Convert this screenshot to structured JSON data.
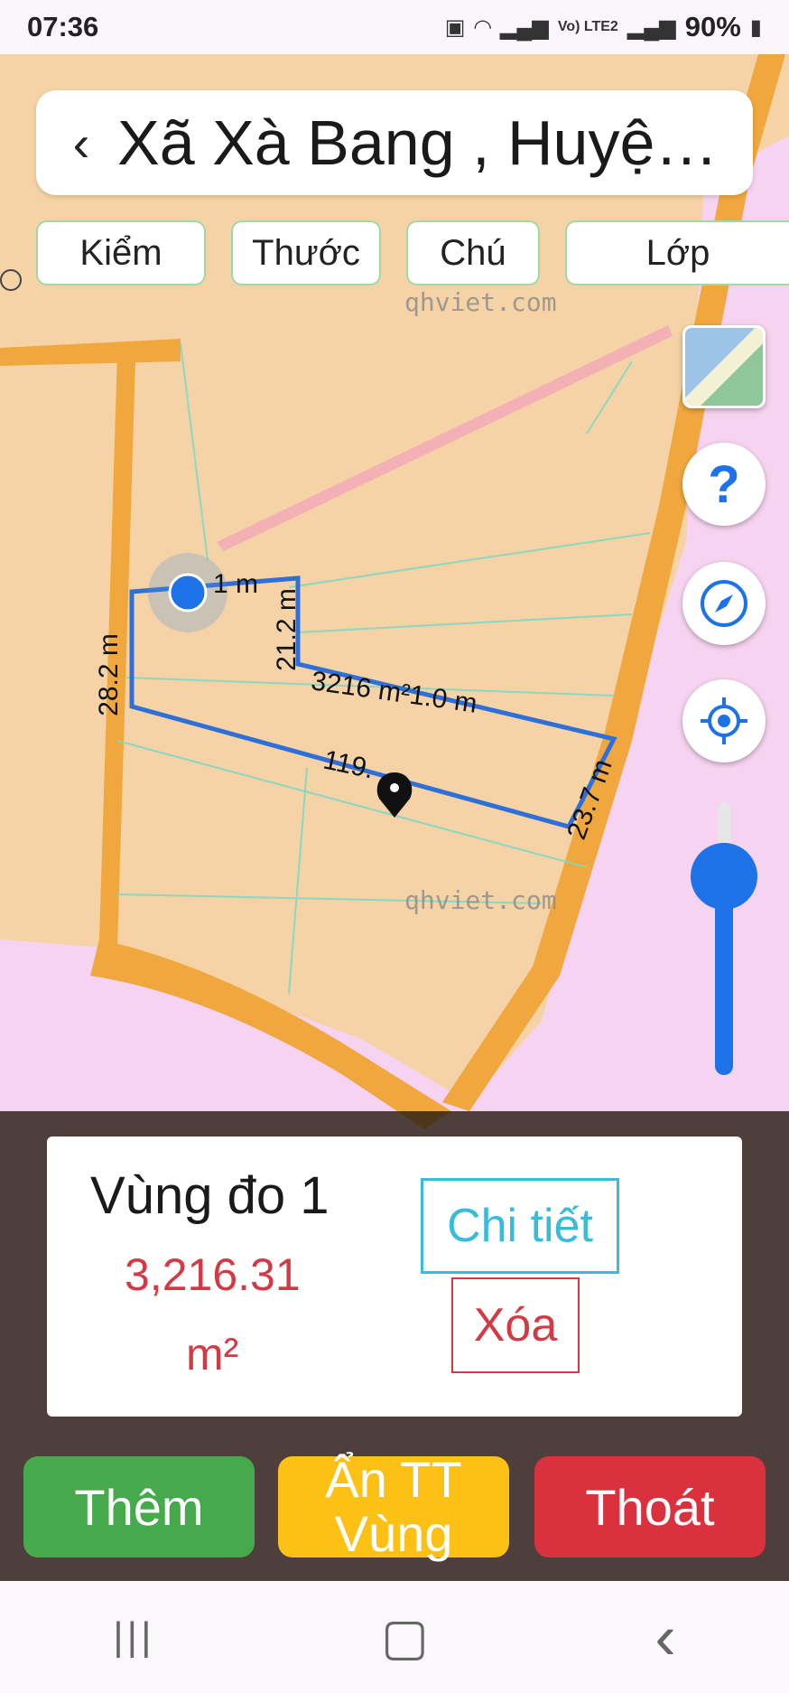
{
  "status": {
    "time": "07:36",
    "network": "Vo) LTE2",
    "battery": "90%"
  },
  "header": {
    "back_icon": "chevron-left",
    "title": "Xã Xà Bang , Huyện..."
  },
  "toolbar": {
    "kiem": "Kiểm",
    "thuoc": "Thước",
    "chu": "Chú",
    "lop": "Lớp"
  },
  "map": {
    "watermark": "qhviet.com",
    "measurements": {
      "top": "1 m",
      "left": "28.2 m",
      "inner_vertical": "21.2 m",
      "middle": "3216 m²1.0 m",
      "bottom": "119.",
      "right": "23.7 m"
    },
    "colors": {
      "land": "#f5d3a6",
      "road": "#f0a83e",
      "residential": "#f6d3f0",
      "polygon": "#2f6fd8"
    }
  },
  "controls": {
    "help": "?",
    "zoom_level": 0.75
  },
  "panel": {
    "area_name": "Vùng đo 1",
    "area_value": "3,216.31",
    "area_unit": "m²",
    "detail_label": "Chi tiết",
    "delete_label": "Xóa"
  },
  "actions": {
    "add": "Thêm",
    "hide": "Ẩn TT Vùng",
    "exit": "Thoát"
  },
  "navbar": {
    "recent": "|||",
    "home": "▢",
    "back": "‹"
  }
}
